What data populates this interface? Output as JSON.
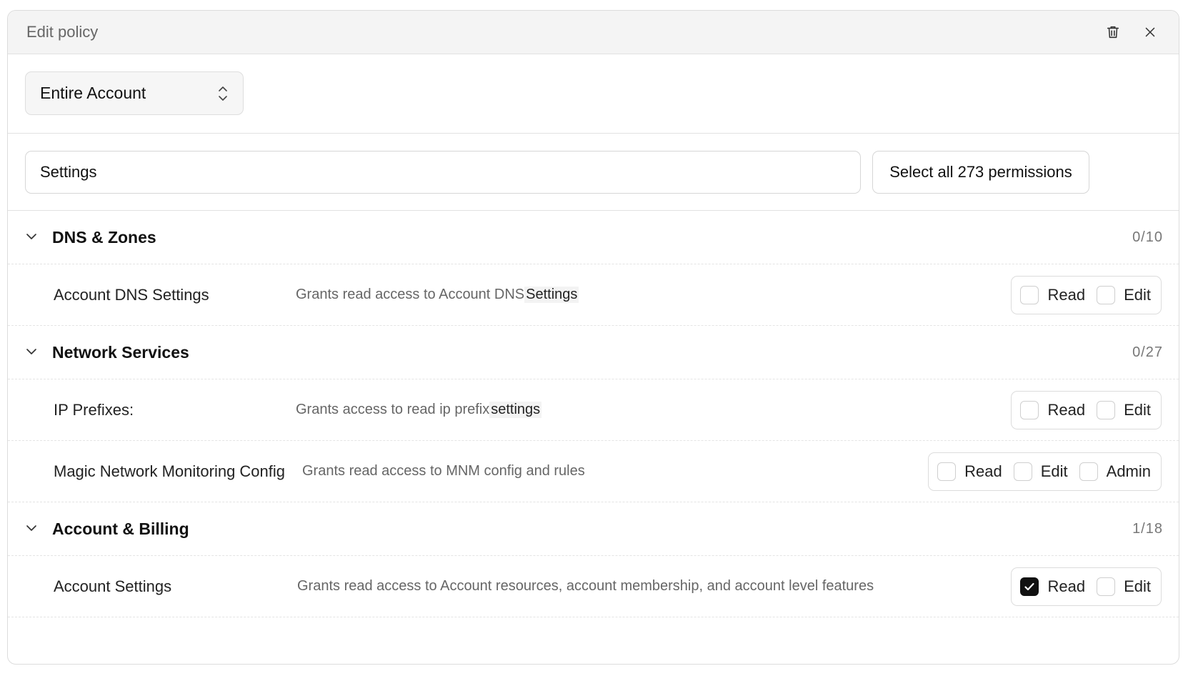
{
  "header": {
    "title": "Edit policy",
    "delete_icon": "trash-icon",
    "close_icon": "close-icon"
  },
  "scope": {
    "selected": "Entire Account"
  },
  "search": {
    "value": "Settings",
    "select_all_label": "Select all 273 permissions"
  },
  "groups": [
    {
      "title": "DNS & Zones",
      "count": "0/10",
      "permissions": [
        {
          "name": "Account DNS Settings",
          "desc_prefix": "Grants read access to Account DNS ",
          "desc_highlight": "Settings",
          "desc_suffix": "",
          "options": [
            {
              "label": "Read",
              "checked": false
            },
            {
              "label": "Edit",
              "checked": false
            }
          ]
        }
      ]
    },
    {
      "title": "Network Services",
      "count": "0/27",
      "permissions": [
        {
          "name": "IP Prefixes:",
          "desc_prefix": "Grants access to read ip prefix ",
          "desc_highlight": "settings",
          "desc_suffix": "",
          "options": [
            {
              "label": "Read",
              "checked": false
            },
            {
              "label": "Edit",
              "checked": false
            }
          ]
        },
        {
          "name": "Magic Network Monitoring Config",
          "desc_prefix": "Grants read access to MNM config and rules",
          "desc_highlight": "",
          "desc_suffix": "",
          "options": [
            {
              "label": "Read",
              "checked": false
            },
            {
              "label": "Edit",
              "checked": false
            },
            {
              "label": "Admin",
              "checked": false
            }
          ]
        }
      ]
    },
    {
      "title": "Account & Billing",
      "count": "1/18",
      "permissions": [
        {
          "name": "Account Settings",
          "desc_prefix": "Grants read access to Account resources, account membership, and account level features",
          "desc_highlight": "",
          "desc_suffix": "",
          "options": [
            {
              "label": "Read",
              "checked": true
            },
            {
              "label": "Edit",
              "checked": false
            }
          ]
        }
      ]
    }
  ]
}
